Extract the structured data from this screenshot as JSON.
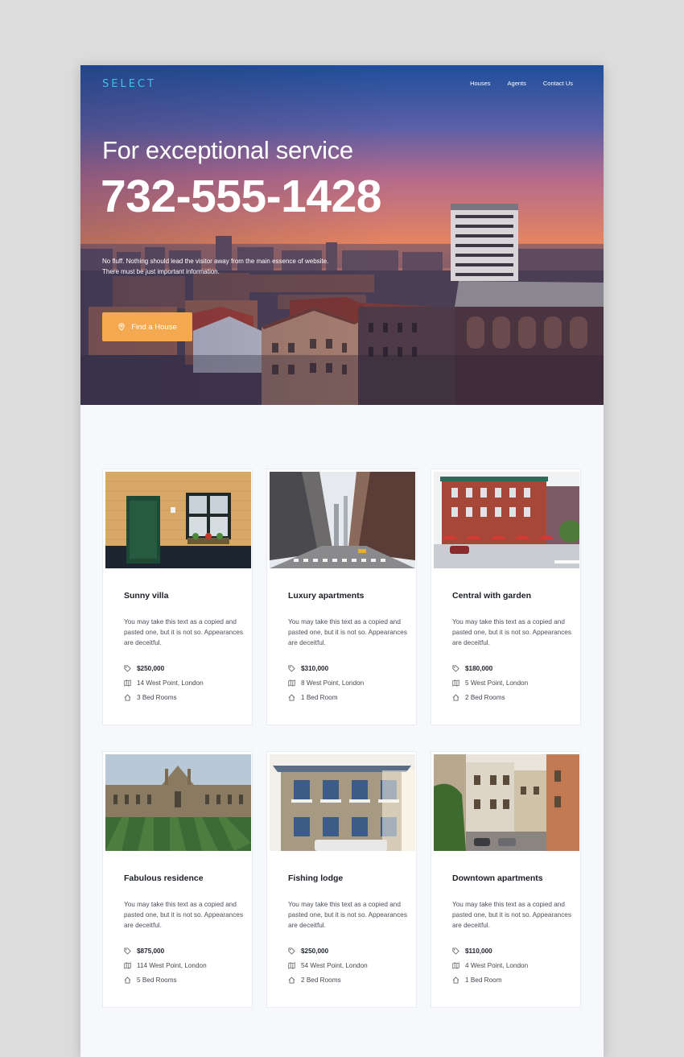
{
  "header": {
    "logo": "SELECT",
    "nav": [
      "Houses",
      "Agents",
      "Contact Us"
    ]
  },
  "hero": {
    "tagline": "For exceptional service",
    "phone": "732-555-1428",
    "description_line1": "No fluff. Nothing should lead the visitor away from the main essence of website.",
    "description_line2": "There must be just important information.",
    "cta_label": "Find a House",
    "cta_icon": "map-pin-icon"
  },
  "colors": {
    "accent": "#f4a950",
    "logo": "#36c3e6"
  },
  "listings": [
    {
      "title": "Sunny villa",
      "desc": "You may take this text as a copied and pasted one, but it is not so. Appearances are deceitful.",
      "price": "$250,000",
      "address": "14 West Point, London",
      "rooms": "3 Bed Rooms"
    },
    {
      "title": "Luxury apartments",
      "desc": "You may take this text as a copied and pasted one, but it is not so. Appearances are deceitful.",
      "price": "$310,000",
      "address": "8 West Point, London",
      "rooms": "1 Bed Room"
    },
    {
      "title": "Central with garden",
      "desc": "You may take this text as a copied and pasted one, but it is not so. Appearances are deceitful.",
      "price": "$180,000",
      "address": "5 West Point, London",
      "rooms": "2 Bed Rooms"
    },
    {
      "title": "Fabulous residence",
      "desc": "You may take this text as a copied and pasted one, but it is not so. Appearances are deceitful.",
      "price": "$875,000",
      "address": "114 West Point, London",
      "rooms": "5 Bed Rooms"
    },
    {
      "title": "Fishing lodge",
      "desc": "You may take this text as a copied and pasted one, but it is not so. Appearances are deceitful.",
      "price": "$250,000",
      "address": "54 West Point, London",
      "rooms": "2 Bed Rooms"
    },
    {
      "title": "Downtown apartments",
      "desc": "You may take this text as a copied and pasted one, but it is not so. Appearances are deceitful.",
      "price": "$110,000",
      "address": "4 West Point, London",
      "rooms": "1 Bed Room"
    }
  ]
}
